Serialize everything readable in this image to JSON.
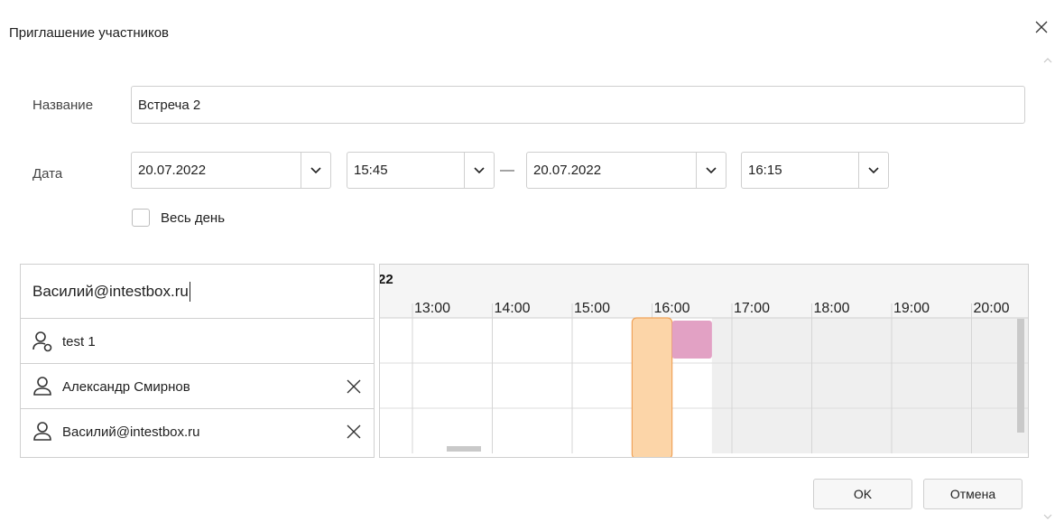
{
  "dialog": {
    "title": "Приглашение участников"
  },
  "form": {
    "name_label": "Название",
    "name_value": "Встреча 2",
    "date_label": "Дата",
    "start_date": "20.07.2022",
    "start_time": "15:45",
    "range_separator": "—",
    "end_date": "20.07.2022",
    "end_time": "16:15",
    "all_day_label": "Весь день",
    "all_day_checked": false
  },
  "participants": {
    "search_value": "Василий@intestbox.ru",
    "items": [
      {
        "name": "test 1",
        "icon": "user-organizer-icon",
        "removable": false
      },
      {
        "name": "Александр Смирнов",
        "icon": "user-icon",
        "removable": true
      },
      {
        "name": "Василий@intestbox.ru",
        "icon": "user-icon",
        "removable": true
      }
    ]
  },
  "schedule": {
    "date_fragment": "22",
    "hours": [
      "13:00",
      "14:00",
      "15:00",
      "16:00",
      "17:00",
      "18:00",
      "19:00",
      "20:00"
    ],
    "meeting": {
      "start": "15:45",
      "end": "16:15",
      "color": "#fcd5a8",
      "border": "#f0a35a"
    },
    "busy": [
      {
        "participant": 0,
        "start": "16:15",
        "end": "16:45",
        "color": "#e2a1c4"
      }
    ],
    "after_hours_from": "16:45",
    "after_hours_color": "#efefef"
  },
  "buttons": {
    "ok": "OK",
    "cancel": "Отмена"
  }
}
